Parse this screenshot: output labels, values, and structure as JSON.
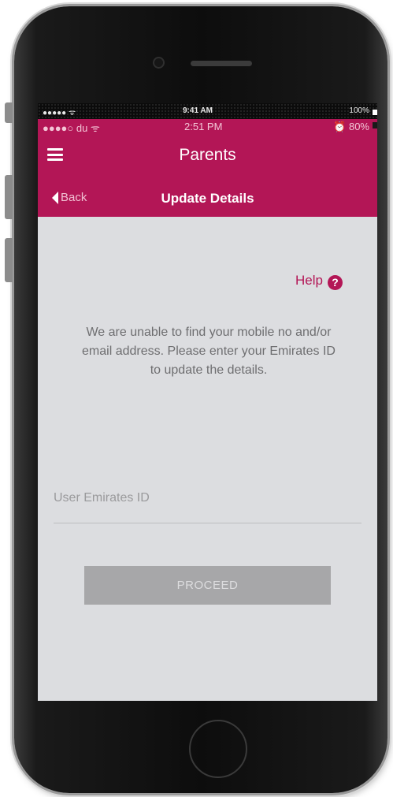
{
  "device_status_bar": {
    "signal": "●●●●● ᯤ",
    "time": "9:41 AM",
    "battery": "100%"
  },
  "app_status_bar": {
    "carrier": "●●●●○ du ᯤ",
    "time": "2:51 PM",
    "battery": "80%"
  },
  "header": {
    "title": "Parents",
    "menu_icon": "hamburger-menu-icon"
  },
  "subheader": {
    "back_label": "Back",
    "title": "Update Details"
  },
  "help": {
    "label": "Help",
    "icon": "?"
  },
  "message": "We are unable to find your mobile no and/or email address. Please enter your Emirates ID to update the details.",
  "form": {
    "emirates_id_placeholder": "User Emirates ID",
    "emirates_id_value": ""
  },
  "proceed_button": {
    "label": "PROCEED"
  },
  "colors": {
    "brand": "#b31656",
    "background": "#dcdde0",
    "button": "#a7a7a9"
  }
}
